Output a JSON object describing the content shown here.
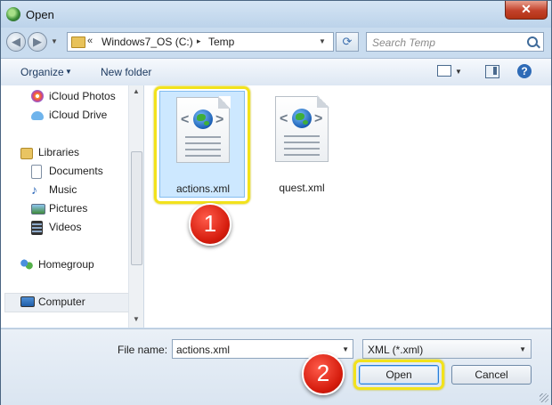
{
  "window": {
    "title": "Open",
    "close_label": "✕"
  },
  "address": {
    "chevron": "«",
    "drive": "Windows7_OS (C:)",
    "separator": "▸",
    "folder": "Temp"
  },
  "search": {
    "placeholder": "Search Temp"
  },
  "toolbar": {
    "organize": "Organize",
    "new_folder": "New folder"
  },
  "nav": {
    "items": [
      {
        "label": "iCloud Photos",
        "icon": "icloud-photos-icon"
      },
      {
        "label": "iCloud Drive",
        "icon": "icloud-drive-icon"
      },
      {
        "label": "Libraries",
        "icon": "libraries-icon"
      },
      {
        "label": "Documents",
        "icon": "documents-icon"
      },
      {
        "label": "Music",
        "icon": "music-icon"
      },
      {
        "label": "Pictures",
        "icon": "pictures-icon"
      },
      {
        "label": "Videos",
        "icon": "videos-icon"
      },
      {
        "label": "Homegroup",
        "icon": "homegroup-icon"
      },
      {
        "label": "Computer",
        "icon": "computer-icon"
      }
    ]
  },
  "files": [
    {
      "name": "actions.xml",
      "selected": true
    },
    {
      "name": "quest.xml",
      "selected": false
    }
  ],
  "annotations": {
    "step1": "1",
    "step2": "2",
    "highlight_color": "#f2e21b",
    "badge_color": "#d51c0d"
  },
  "footer": {
    "file_name_label": "File name:",
    "file_name_value": "actions.xml",
    "filter_value": "XML (*.xml)",
    "open_label": "Open",
    "cancel_label": "Cancel"
  }
}
